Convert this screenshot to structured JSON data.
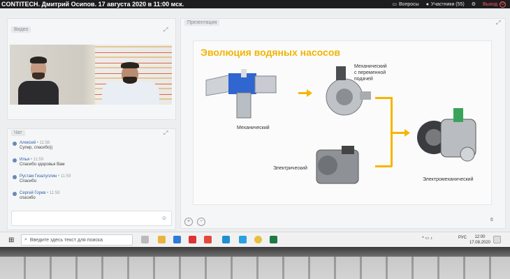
{
  "header": {
    "title": "CONTITECH. Дмитрий Осипов. 17 августа 2020 в 11:00 мск.",
    "questions_label": "Вопросы",
    "participants_label": "Участники (55)",
    "exit_label": "Выход"
  },
  "video": {
    "label": "Видео"
  },
  "chat": {
    "label": "Чат",
    "messages": [
      {
        "name": "Алексей",
        "time": "11:58",
        "text": "Супер, спасибо))"
      },
      {
        "name": "Илья",
        "time": "11:59",
        "text": "Спасибо здоровья Вам"
      },
      {
        "name": "Рустам Гизатуллин",
        "time": "11:59",
        "text": "Спасибо"
      },
      {
        "name": "Сергей Горев",
        "time": "11:59",
        "text": "спасибо"
      }
    ]
  },
  "presentation": {
    "label": "Презентация",
    "slide_title": "Эволюция водяных насосов",
    "labels": {
      "mechanical": "Механический",
      "variable": [
        "Механический",
        "с переменной",
        "подачей"
      ],
      "electric": "Электрический",
      "electromech": "Электромеханический"
    },
    "page": "6",
    "zoom_in": "+",
    "zoom_out": "−"
  },
  "taskbar": {
    "search_placeholder": "Введите здесь текст для поиска",
    "lang": "РУС",
    "time": "12:00",
    "date": "17.08.2020"
  },
  "colors": {
    "accent": "#f7b500",
    "exit": "#ff5b5b"
  }
}
